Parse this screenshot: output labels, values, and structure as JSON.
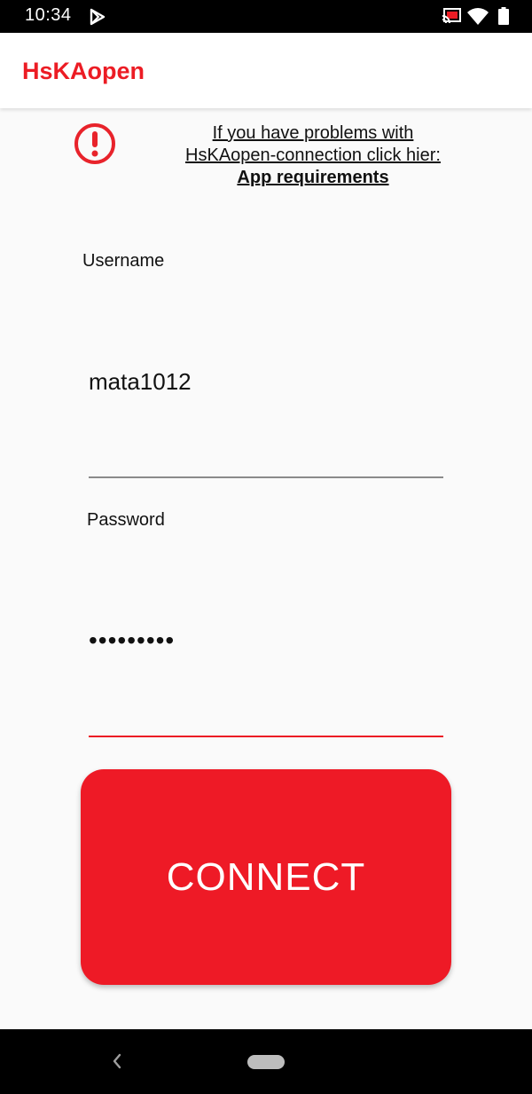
{
  "status_bar": {
    "time": "10:34",
    "icons": [
      "play-store-icon",
      "cast-icon",
      "wifi-icon",
      "battery-icon"
    ]
  },
  "app_bar": {
    "title": "HsKAopen",
    "title_color": "#ec1c24"
  },
  "help": {
    "line1": "If you have problems with",
    "line2": "HsKAopen-connection click hier:",
    "link_label": "App requirements",
    "icon": "warning-circle-icon"
  },
  "form": {
    "username_label": "Username",
    "username_value": "mata1012",
    "password_label": "Password",
    "password_value": "•••••••••"
  },
  "connect_button": {
    "label": "CONNECT",
    "color": "#ee1a26"
  },
  "nav_bar": {
    "icons": [
      "back-icon",
      "home-pill-icon"
    ]
  }
}
